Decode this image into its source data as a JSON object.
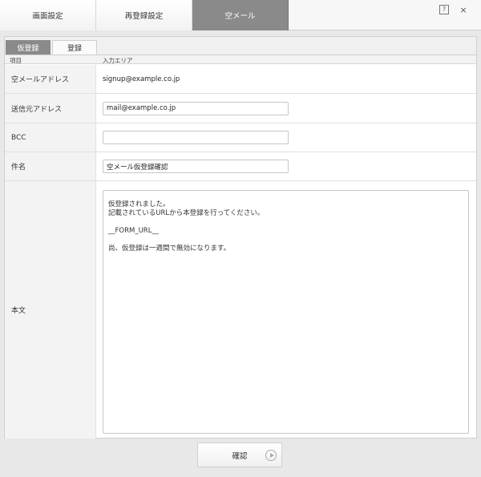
{
  "top_tabs": [
    {
      "label": "画面設定"
    },
    {
      "label": "再登録設定"
    },
    {
      "label": "空メール",
      "active": true
    }
  ],
  "window_buttons": {
    "help": "?",
    "close": "×"
  },
  "sub_tabs": [
    {
      "label": "仮登録",
      "active": true
    },
    {
      "label": "登録"
    }
  ],
  "table": {
    "header": {
      "col1": "項目",
      "col2": "入力エリア"
    },
    "rows": [
      {
        "label": "空メールアドレス",
        "value": "signup@example.co.jp"
      },
      {
        "label": "送信元アドレス",
        "value": "mail@example.co.jp"
      },
      {
        "label": "BCC",
        "value": ""
      },
      {
        "label": "件名",
        "value": "空メール仮登録確認"
      },
      {
        "label": "本文",
        "value": "仮登録されました。\n記載されているURLから本登録を行ってください。\n\n__FORM_URL__\n\n尚、仮登録は一週間で無効になります。"
      }
    ]
  },
  "footer": {
    "confirm_label": "確認"
  }
}
